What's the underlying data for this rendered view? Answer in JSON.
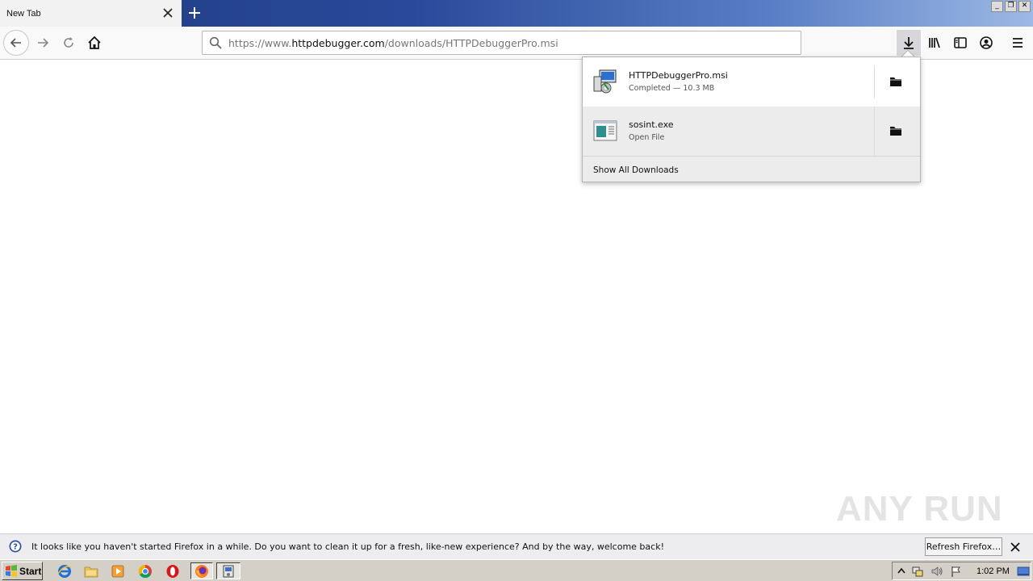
{
  "tab": {
    "title": "New Tab"
  },
  "window_controls": {
    "minimize": "_",
    "restore": "❐",
    "close": "✕"
  },
  "urlbar": {
    "prefix": "https://www.",
    "domain": "httpdebugger.com",
    "path": "/downloads/HTTPDebuggerPro.msi"
  },
  "downloads": {
    "items": [
      {
        "name": "HTTPDebuggerPro.msi",
        "status": "Completed — 10.3 MB",
        "icon": "msi-installer-icon"
      },
      {
        "name": "sosint.exe",
        "status": "Open File",
        "icon": "exe-file-icon"
      }
    ],
    "footer": "Show All Downloads"
  },
  "notification": {
    "text": "It looks like you haven't started Firefox in a while. Do you want to clean it up for a fresh, like-new experience? And by the way, welcome back!",
    "button": "Refresh Firefox…"
  },
  "watermark": "ANY RUN",
  "taskbar": {
    "start": "Start",
    "clock": "1:02 PM"
  },
  "colors": {
    "titlebar": "#294a9a",
    "panel_highlight": "#ececec",
    "notification_bg": "#ededf0"
  }
}
